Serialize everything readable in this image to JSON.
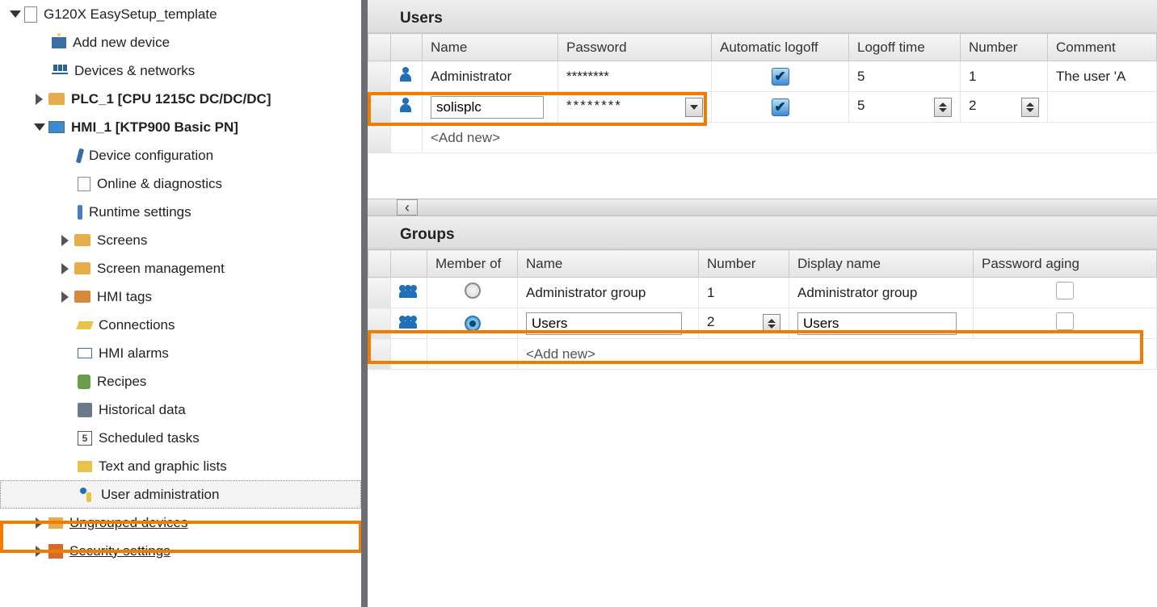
{
  "tree": {
    "project": "G120X EasySetup_template",
    "add_device": "Add new device",
    "devices_networks": "Devices & networks",
    "plc": "PLC_1 [CPU 1215C DC/DC/DC]",
    "hmi": "HMI_1 [KTP900 Basic PN]",
    "device_config": "Device configuration",
    "online_diag": "Online & diagnostics",
    "runtime_settings": "Runtime settings",
    "screens": "Screens",
    "screen_mgmt": "Screen management",
    "hmi_tags": "HMI tags",
    "connections": "Connections",
    "hmi_alarms": "HMI alarms",
    "recipes": "Recipes",
    "historical": "Historical data",
    "scheduled": "Scheduled tasks",
    "scheduled_num": "5",
    "text_graphic": "Text and graphic lists",
    "user_admin": "User administration",
    "ungrouped": "Ungrouped devices",
    "security": "Security settings"
  },
  "users": {
    "title": "Users",
    "headers": {
      "name": "Name",
      "password": "Password",
      "auto_logoff": "Automatic logoff",
      "logoff_time": "Logoff time",
      "number": "Number",
      "comment": "Comment"
    },
    "rows": [
      {
        "name": "Administrator",
        "password": "********",
        "auto_logoff": true,
        "logoff_time": "5",
        "number": "1",
        "comment": "The user 'A"
      },
      {
        "name": "solisplc",
        "password": "********",
        "auto_logoff": true,
        "logoff_time": "5",
        "number": "2",
        "comment": ""
      }
    ],
    "add_new": "<Add new>"
  },
  "groups": {
    "title": "Groups",
    "headers": {
      "member_of": "Member of",
      "name": "Name",
      "number": "Number",
      "display_name": "Display name",
      "password_aging": "Password aging"
    },
    "rows": [
      {
        "member": false,
        "name": "Administrator group",
        "number": "1",
        "display_name": "Administrator group",
        "aging": false
      },
      {
        "member": true,
        "name": "Users",
        "number": "2",
        "display_name": "Users",
        "aging": false
      }
    ],
    "add_new": "<Add new>"
  }
}
